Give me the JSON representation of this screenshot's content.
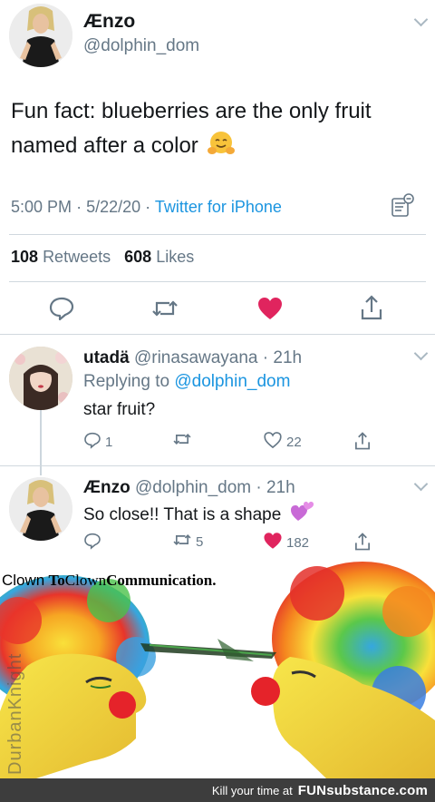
{
  "main_tweet": {
    "display_name": "Ænzo",
    "handle": "@dolphin_dom",
    "text": "Fun fact: blueberries are the only fruit named after a color",
    "time": "5:00 PM",
    "date": "5/22/20",
    "source": "Twitter for iPhone",
    "retweets_count": "108",
    "retweets_label": "Retweets",
    "likes_count": "608",
    "likes_label": "Likes",
    "liked": true
  },
  "reply1": {
    "display_name": "utadä",
    "handle": "@rinasawayana",
    "time": "21h",
    "replying_prefix": "Replying to",
    "replying_handle": "@dolphin_dom",
    "text": "star fruit?",
    "reply_count": "1",
    "like_count": "22"
  },
  "reply2": {
    "display_name": "Ænzo",
    "handle": "@dolphin_dom",
    "time": "21h",
    "text": "So close!! That is a shape",
    "retweet_count": "5",
    "like_count": "182",
    "liked": true
  },
  "meme": {
    "caption_1": "Clown",
    "caption_2": "To",
    "caption_3": "Clown",
    "caption_4": "Communication.",
    "watermark": "DurbanKnight"
  },
  "footer": {
    "text": "Kill your time at",
    "brand": "FUNsubstance.com"
  },
  "icons": [
    "chevron-down-icon",
    "hugging-face-emoji",
    "analytics-icon",
    "reply-icon",
    "retweet-icon",
    "heart-icon",
    "share-icon",
    "sparkling-hearts-emoji"
  ],
  "colors": {
    "text": "#14171a",
    "secondary": "#657786",
    "link": "#1b95e0",
    "like": "#e0245e",
    "divider": "#d0d8de"
  }
}
